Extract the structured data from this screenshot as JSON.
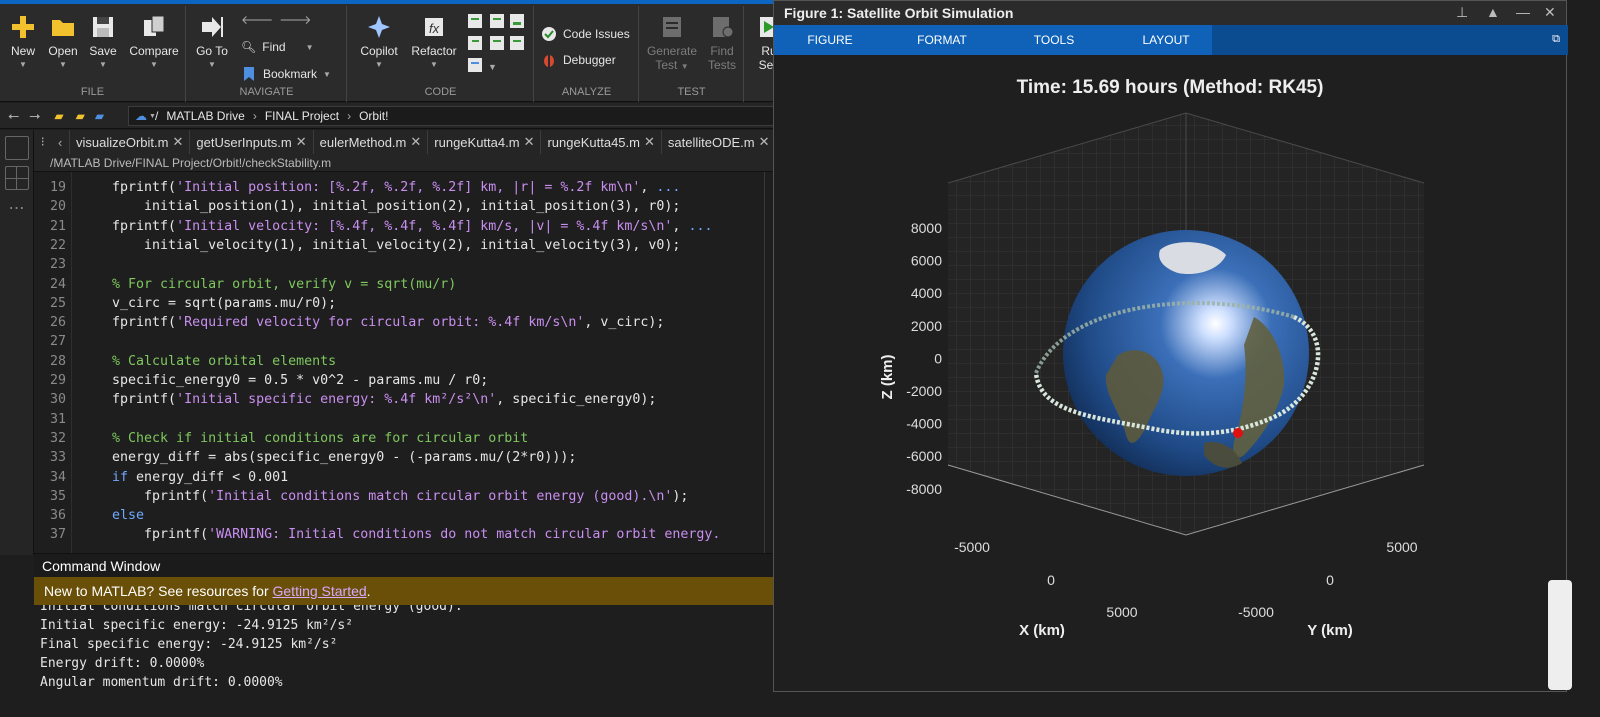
{
  "toolstrip": {
    "file_group": {
      "label": "FILE",
      "new": "New",
      "open": "Open",
      "save": "Save",
      "compare": "Compare"
    },
    "navigate_group": {
      "label": "NAVIGATE",
      "go_to": "Go To",
      "find": "Find",
      "bookmark": "Bookmark"
    },
    "code_group": {
      "label": "CODE",
      "copilot": "Copilot",
      "refactor": "Refactor"
    },
    "analyze_group": {
      "label": "ANALYZE",
      "code_issues": "Code Issues",
      "debugger": "Debugger"
    },
    "test_group": {
      "label": "TEST",
      "generate_test_1": "Generate",
      "generate_test_2": "Test",
      "find_tests_1": "Find",
      "find_tests_2": "Tests"
    },
    "run_group": {
      "run_1": "Ru",
      "run_2": "Sec"
    }
  },
  "address": {
    "root": "/",
    "crumbs": [
      "MATLAB Drive",
      "FINAL Project",
      "Orbit!"
    ]
  },
  "editor": {
    "tabs": [
      {
        "label": "visualizeOrbit.m"
      },
      {
        "label": "getUserInputs.m"
      },
      {
        "label": "eulerMethod.m"
      },
      {
        "label": "rungeKutta4.m"
      },
      {
        "label": "rungeKutta45.m"
      },
      {
        "label": "satelliteODE.m"
      }
    ],
    "filepath": "/MATLAB Drive/FINAL Project/Orbit!/checkStability.m",
    "lines": [
      {
        "n": "19",
        "text": "    fprintf('Initial position: [%.2f, %.2f, %.2f] km, |r| = %.2f km\\n', ...",
        "kind": "fprintf"
      },
      {
        "n": "20",
        "text": "        initial_position(1), initial_position(2), initial_position(3), r0);",
        "kind": "plain"
      },
      {
        "n": "21",
        "text": "    fprintf('Initial velocity: [%.4f, %.4f, %.4f] km/s, |v| = %.4f km/s\\n', ...",
        "kind": "fprintf"
      },
      {
        "n": "22",
        "text": "        initial_velocity(1), initial_velocity(2), initial_velocity(3), v0);",
        "kind": "plain"
      },
      {
        "n": "23",
        "text": "",
        "kind": "plain"
      },
      {
        "n": "24",
        "text": "    % For circular orbit, verify v = sqrt(mu/r)",
        "kind": "comment"
      },
      {
        "n": "25",
        "text": "    v_circ = sqrt(params.mu/r0);",
        "kind": "plain"
      },
      {
        "n": "26",
        "text": "    fprintf('Required velocity for circular orbit: %.4f km/s\\n', v_circ);",
        "kind": "fprintf"
      },
      {
        "n": "27",
        "text": "",
        "kind": "plain"
      },
      {
        "n": "28",
        "text": "    % Calculate orbital elements",
        "kind": "comment"
      },
      {
        "n": "29",
        "text": "    specific_energy0 = 0.5 * v0^2 - params.mu / r0;",
        "kind": "plain"
      },
      {
        "n": "30",
        "text": "    fprintf('Initial specific energy: %.4f km²/s²\\n', specific_energy0);",
        "kind": "fprintf"
      },
      {
        "n": "31",
        "text": "",
        "kind": "plain"
      },
      {
        "n": "32",
        "text": "    % Check if initial conditions are for circular orbit",
        "kind": "comment"
      },
      {
        "n": "33",
        "text": "    energy_diff = abs(specific_energy0 - (-params.mu/(2*r0)));",
        "kind": "plain"
      },
      {
        "n": "34",
        "text": "    if energy_diff < 0.001",
        "kind": "keyword"
      },
      {
        "n": "35",
        "text": "        fprintf('Initial conditions match circular orbit energy (good).\\n');",
        "kind": "fprintf"
      },
      {
        "n": "36",
        "text": "    else",
        "kind": "keyword"
      },
      {
        "n": "37",
        "text": "        fprintf('WARNING: Initial conditions do not match circular orbit energy.",
        "kind": "fprintf"
      }
    ]
  },
  "command_window": {
    "title": "Command Window",
    "banner_text": "New to MATLAB? See resources for ",
    "banner_link": "Getting Started",
    "banner_end": ".",
    "output": [
      "Initial conditions match circular orbit energy (good).",
      "Initial specific energy: -24.9125 km²/s²",
      "Final specific energy: -24.9125 km²/s²",
      "Energy drift: 0.0000%",
      "Angular momentum drift: 0.0000%"
    ]
  },
  "figure": {
    "window_title": "Figure 1: Satellite Orbit Simulation",
    "tabs": [
      "FIGURE",
      "FORMAT",
      "TOOLS",
      "LAYOUT"
    ],
    "plot_title": "Time: 15.69 hours (Method: RK45)",
    "zlabel": "Z (km)",
    "xlabel": "X (km)",
    "ylabel": "Y (km)",
    "z_ticks": [
      "8000",
      "6000",
      "4000",
      "2000",
      "0",
      "-2000",
      "-4000",
      "-6000",
      "-8000"
    ],
    "x_ticks": [
      "-5000",
      "0",
      "5000"
    ],
    "y_ticks": [
      "5000",
      "0",
      "-5000"
    ]
  },
  "colors": {
    "accent": "#0f62b8",
    "banner": "#6a4f08",
    "string": "#c98ef0",
    "comment": "#7ec85e",
    "keyword": "#6ea8ff",
    "orbit_marker": "#e01010"
  }
}
